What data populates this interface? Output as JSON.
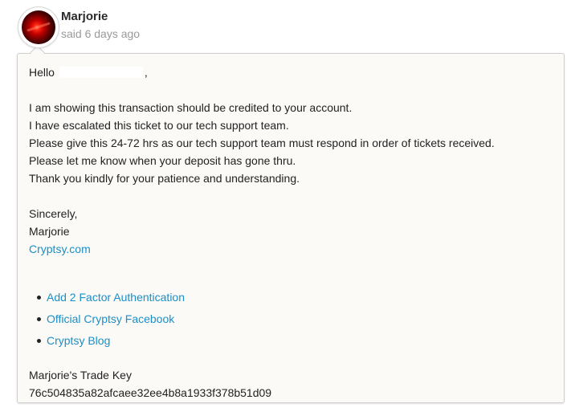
{
  "comment": {
    "author": "Marjorie",
    "timestamp": "said 6 days ago",
    "greeting": "Hello",
    "greeting_suffix": ",",
    "body_lines": [
      "I am showing this transaction should be credited to your account.",
      "I have escalated this ticket to our tech support team.",
      "Please give this 24-72 hrs as our tech support team must respond in order of tickets received.",
      "Please let me know when your deposit has gone thru.",
      "Thank you kindly for your patience and understanding."
    ],
    "signoff": "Sincerely,",
    "signature_name": "Marjorie",
    "signature_site": "Cryptsy.com",
    "links": [
      "Add 2 Factor Authentication",
      "Official Cryptsy Facebook",
      "Cryptsy Blog"
    ],
    "trade_key_label": "Marjorie's Trade Key",
    "trade_key": "76c504835a82afcaee32ee4b8a1933f378b51d09"
  },
  "colors": {
    "link": "#1a8fc9",
    "bubble_background": "#fbfaf6",
    "bubble_border": "#cfcfcf",
    "timestamp": "#9a9a9a"
  },
  "icons": {
    "avatar": "user-avatar"
  }
}
